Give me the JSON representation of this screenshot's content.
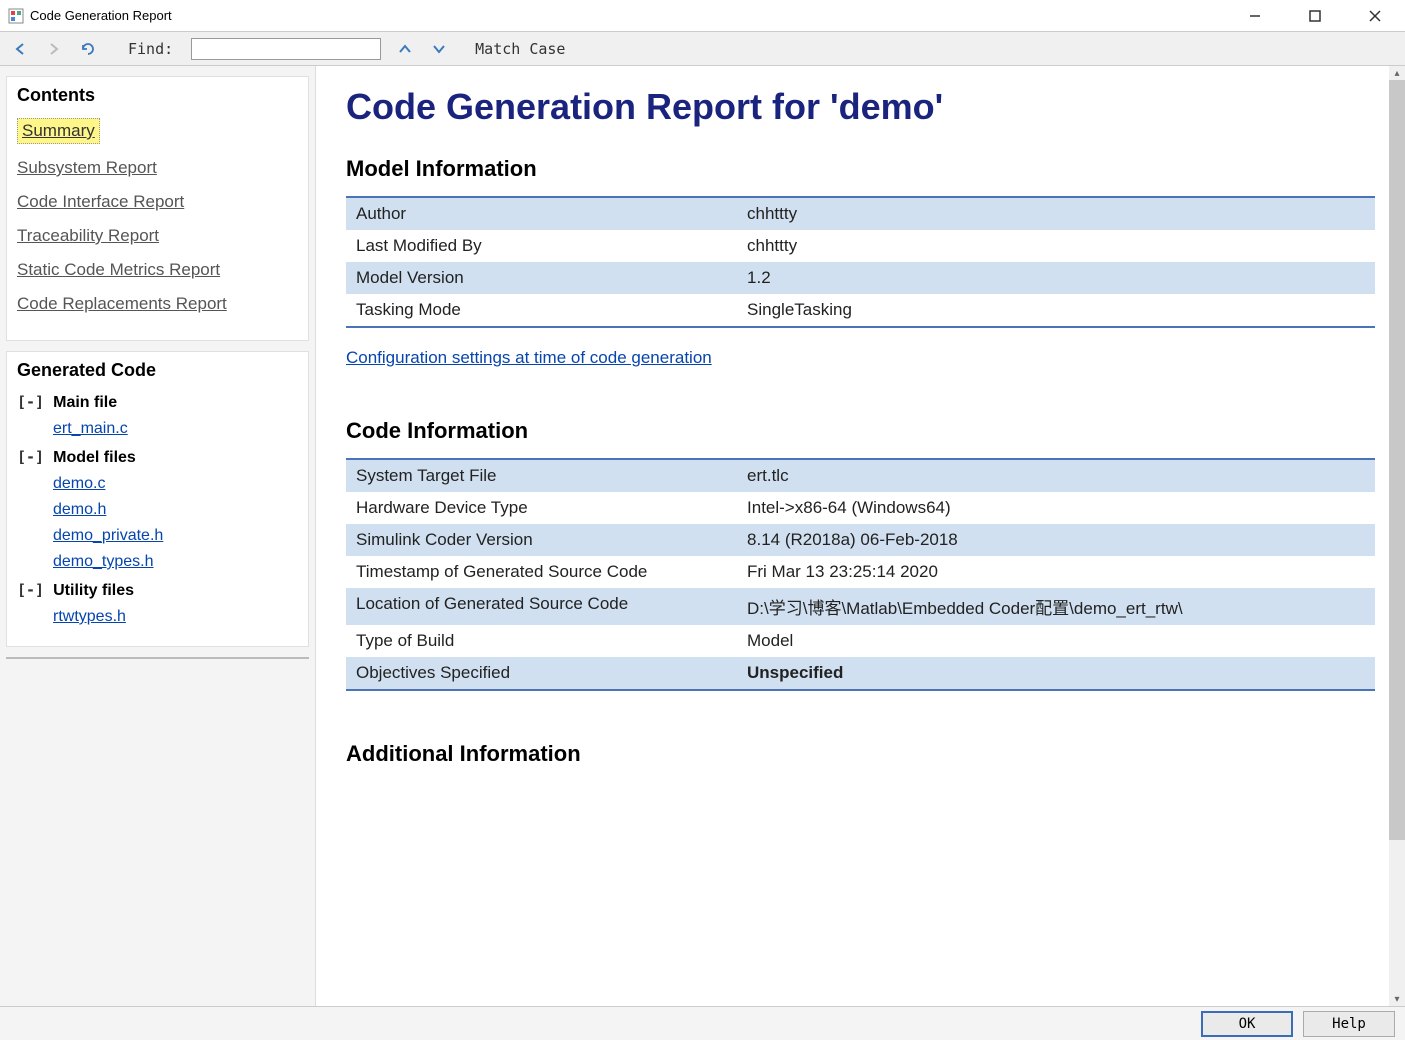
{
  "titlebar": {
    "text": "Code Generation Report"
  },
  "toolbar": {
    "find_label": "Find:",
    "find_value": "",
    "match_case": "Match Case"
  },
  "sidebar": {
    "contents_title": "Contents",
    "contents_items": [
      {
        "label": "Summary",
        "active": true
      },
      {
        "label": "Subsystem Report",
        "active": false
      },
      {
        "label": "Code Interface Report",
        "active": false
      },
      {
        "label": "Traceability Report",
        "active": false
      },
      {
        "label": "Static Code Metrics Report",
        "active": false
      },
      {
        "label": "Code Replacements Report",
        "active": false
      }
    ],
    "generated_title": "Generated Code",
    "groups": [
      {
        "toggle": "[-]",
        "title": "Main file",
        "files": [
          "ert_main.c"
        ]
      },
      {
        "toggle": "[-]",
        "title": "Model files",
        "files": [
          "demo.c",
          "demo.h",
          "demo_private.h",
          "demo_types.h"
        ]
      },
      {
        "toggle": "[-]",
        "title": "Utility files",
        "files": [
          "rtwtypes.h"
        ]
      }
    ]
  },
  "content": {
    "page_title": "Code Generation Report for 'demo'",
    "model_info_title": "Model Information",
    "model_info_rows": [
      {
        "k": "Author",
        "v": "chhttty"
      },
      {
        "k": "Last Modified By",
        "v": "chhttty"
      },
      {
        "k": "Model Version",
        "v": "1.2"
      },
      {
        "k": "Tasking Mode",
        "v": "SingleTasking"
      }
    ],
    "config_link": "Configuration settings at time of code generation",
    "code_info_title": "Code Information",
    "code_info_rows": [
      {
        "k": "System Target File",
        "v": "ert.tlc"
      },
      {
        "k": "Hardware Device Type",
        "v": "Intel->x86-64 (Windows64)"
      },
      {
        "k": "Simulink Coder Version",
        "v": "8.14 (R2018a) 06-Feb-2018"
      },
      {
        "k": "Timestamp of Generated Source Code",
        "v": "Fri Mar 13 23:25:14 2020"
      },
      {
        "k": "Location of Generated Source Code",
        "v": "D:\\学习\\博客\\Matlab\\Embedded Coder配置\\demo_ert_rtw\\"
      },
      {
        "k": "Type of Build",
        "v": "Model"
      },
      {
        "k": "Objectives Specified",
        "v": "Unspecified",
        "orange": true
      }
    ],
    "additional_title": "Additional Information"
  },
  "footer": {
    "ok": "OK",
    "help": "Help"
  }
}
